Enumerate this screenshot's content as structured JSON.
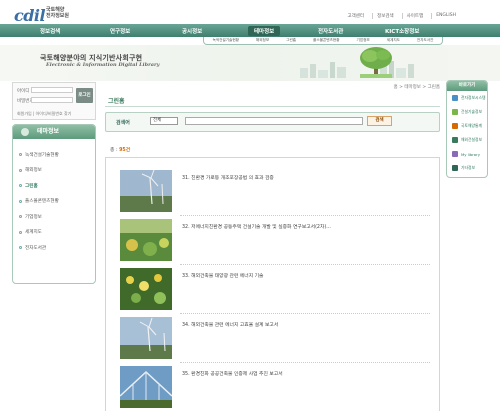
{
  "header": {
    "logo_text": "cdil",
    "logo_sub_1": "국토해양",
    "logo_sub_2": "전자정보원",
    "top_links": [
      "고객센터",
      "정보검색",
      "사이트맵",
      "ENGLISH"
    ]
  },
  "gnb": {
    "items": [
      "정보검색",
      "연구정보",
      "공시정보",
      "테마정보",
      "전자도서관",
      "KICT소장정보"
    ],
    "active_index": 3
  },
  "subnav": {
    "items": [
      "녹색건설기술현황",
      "해외정보",
      "그린홈",
      "플스몰콘텐츠현황",
      "기업정보",
      "세계지도",
      "전자도서관"
    ]
  },
  "banner": {
    "title": "국토해양분야의 지식기반사회구현",
    "subtitle": "Electronic & Information Digital Library"
  },
  "login": {
    "id_label": "아이디",
    "pw_label": "비밀번호",
    "button": "로그인",
    "links": "회원가입 | 아이디/비밀번호 찾기"
  },
  "lnb": {
    "title": "테마정보",
    "items": [
      "녹색건설기술현황",
      "해외정보",
      "그린홈",
      "플스몰콘텐츠현황",
      "기업정보",
      "세계지도",
      "전자도서관"
    ],
    "active_index": 2
  },
  "breadcrumb": "홈 > 테마정보 > 그린홈",
  "page_title": "그린홈",
  "search": {
    "label": "검색어",
    "select_value": "전체",
    "button": "검색"
  },
  "count": {
    "label": "총 :",
    "value": "95건"
  },
  "results": [
    {
      "num": "31.",
      "title": "친환경 가로등 개조포장공법 의 효과 검증"
    },
    {
      "num": "32.",
      "title": "저에너지친환경 공동주택 건설기술 개발 및 실증화 연구보고서(2차)..."
    },
    {
      "num": "33.",
      "title": "해외건축물 태양광 관련 에너지 기술"
    },
    {
      "num": "34.",
      "title": "해외건축물 관련 에너지 고효율 설계 보고서"
    },
    {
      "num": "35.",
      "title": "환경친화 공공건축물 인증제 사업 추진 보고서"
    }
  ],
  "right_panel": {
    "title": "바로가기",
    "items": [
      "전자정보시스템",
      "건설기술정보",
      "국토해양통계",
      "해외건설정보",
      "My library",
      "기타정보"
    ],
    "icon_colors": [
      "#4a90c8",
      "#7ab648",
      "#d66a00",
      "#3a7a5c",
      "#8a6ab8",
      "#2f6656"
    ]
  },
  "colors": {
    "accent": "#3a7a5c",
    "gnb": "#4f8e7c",
    "highlight": "#d66a00"
  }
}
